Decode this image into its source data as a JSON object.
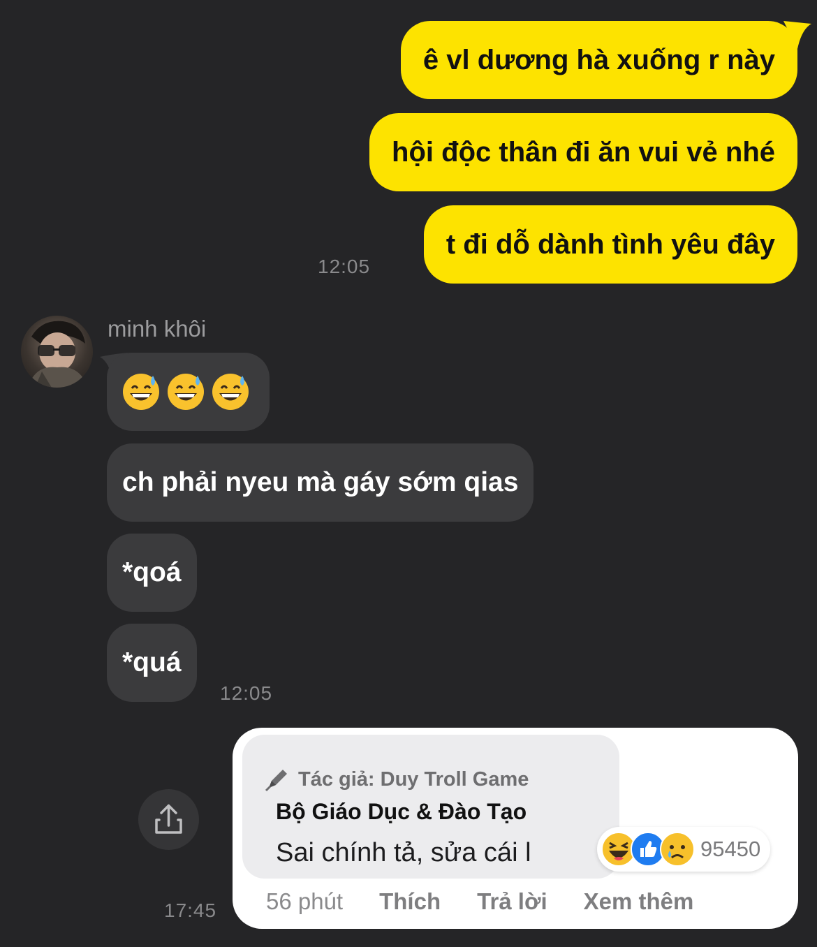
{
  "messages_out": [
    {
      "text": "ê vl dương hà xuống r này"
    },
    {
      "text": "hội độc thân đi ăn vui vẻ nhé"
    },
    {
      "text": "t đi dỗ dành tình yêu đây"
    }
  ],
  "time_out": "12:05",
  "sender": {
    "name": "minh khôi"
  },
  "messages_in": [
    {
      "text": "ch phải nyeu mà gáy sớm qias"
    },
    {
      "text": "*qoá"
    },
    {
      "text": "*quá"
    }
  ],
  "emoji_message": [
    "grinning-sweat-emoji",
    "grinning-sweat-emoji",
    "grinning-sweat-emoji"
  ],
  "time_in": "12:05",
  "image_message": {
    "time": "17:45",
    "author_line": "Tác giả: Duy Troll Game",
    "page_name": "Bộ Giáo Dục & Đào Tạo",
    "comment": "Sai chính tả, sửa cái l",
    "reaction_count": "95450",
    "reactions": [
      "haha",
      "like",
      "sad"
    ],
    "actions": {
      "time_ago": "56 phút",
      "like": "Thích",
      "reply": "Trả lời",
      "more": "Xem thêm"
    }
  },
  "colors": {
    "background": "#252527",
    "bubble_out": "#fde300",
    "bubble_in": "#3b3b3d"
  }
}
